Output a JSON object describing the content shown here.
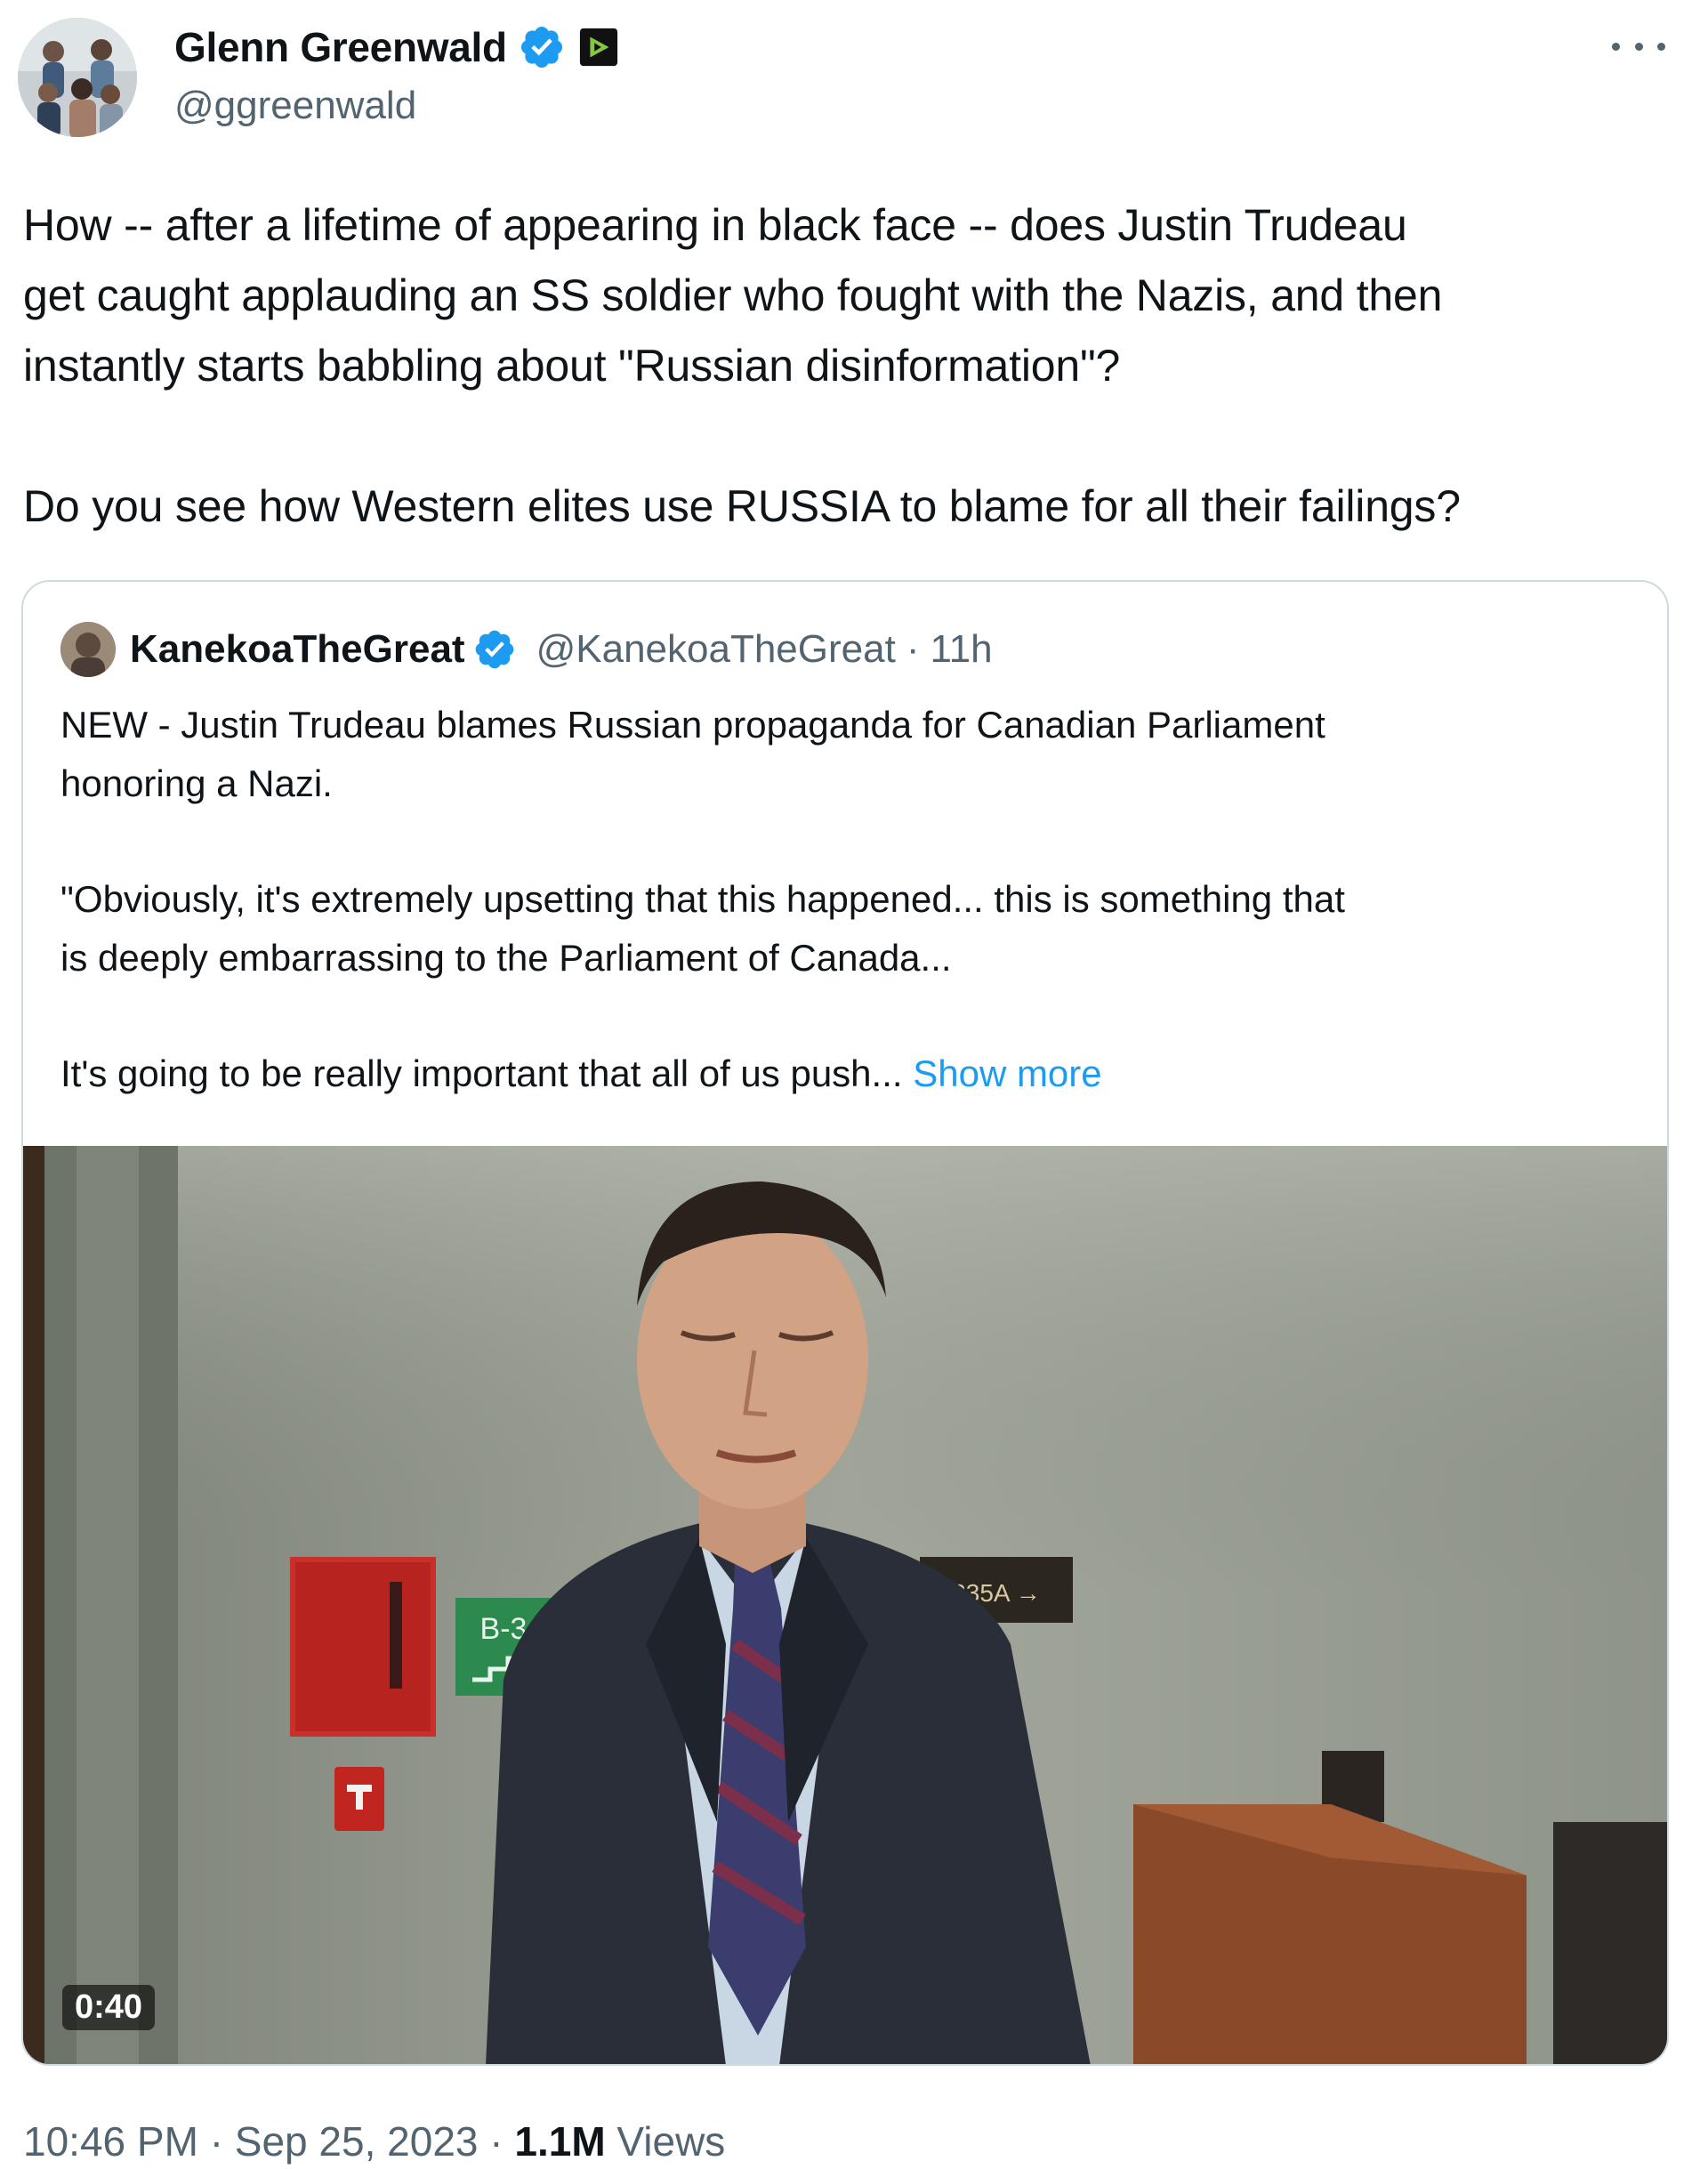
{
  "author": {
    "display_name": "Glenn Greenwald",
    "handle": "@ggreenwald",
    "avatar": "group-photo-avatar",
    "verified_icon": "verified-badge-icon",
    "affiliate_icon": "rumble-badge-icon",
    "more_icon": "more-options-icon"
  },
  "tweet": {
    "lines": [
      "How -- after a lifetime of appearing in black face -- does Justin Trudeau",
      "get caught applauding an SS soldier who fought with the Nazis, and then",
      "instantly starts babbling about \"Russian disinformation\"?"
    ],
    "line2": "Do you see how Western elites use RUSSIA to blame for all their failings?"
  },
  "quote": {
    "display_name": "KanekoaTheGreat",
    "handle": "@KanekoaTheGreat",
    "separator": "·",
    "time": "11h",
    "para1": [
      "NEW - Justin Trudeau blames Russian propaganda for Canadian Parliament",
      "honoring a Nazi."
    ],
    "para2": [
      "\"Obviously, it's extremely upsetting that this happened... this is something that",
      "is deeply embarrassing to the Parliament of Canada..."
    ],
    "para3": "It's going to be really important that all of us push...",
    "show_more": "Show more",
    "video_duration": "0:40",
    "sign_text": "B-3",
    "room_sign_text": "235A →"
  },
  "meta": {
    "time": "10:46 PM",
    "sep1": "·",
    "date": "Sep 25, 2023",
    "sep2": "·",
    "views_count": "1.1M",
    "views_label": "Views"
  },
  "colors": {
    "link": "#1d9bf0",
    "verified": "#1d9bf0",
    "secondary_text": "#536471",
    "primary_text": "#0f1419",
    "border": "#cfd9de"
  }
}
